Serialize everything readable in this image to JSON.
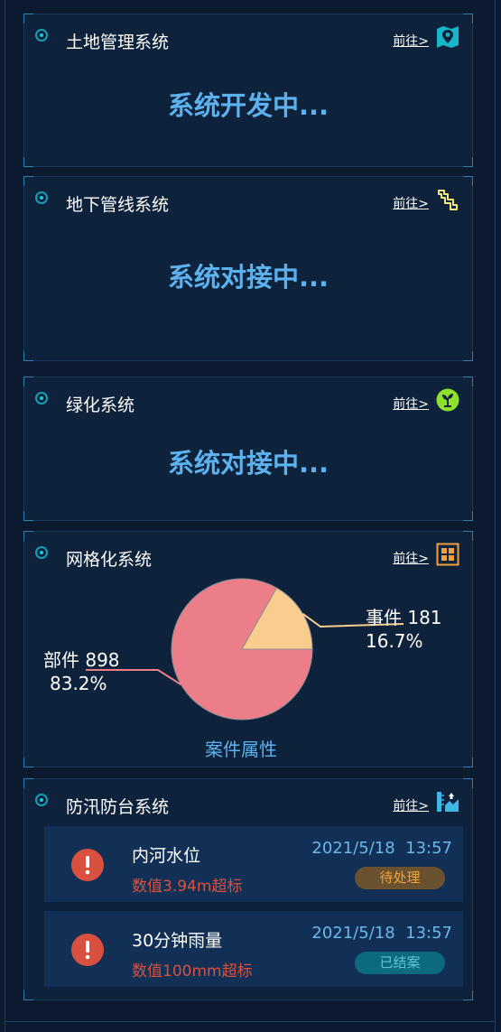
{
  "panels": {
    "land": {
      "title": "土地管理系统",
      "goto_label": "前往>",
      "icon": "map-pin-icon",
      "status": "系统开发中..."
    },
    "pipeline": {
      "title": "地下管线系统",
      "goto_label": "前往>",
      "icon": "pipe-icon",
      "status": "系统对接中..."
    },
    "greening": {
      "title": "绿化系统",
      "goto_label": "前往>",
      "icon": "plant-icon",
      "status": "系统对接中..."
    },
    "grid": {
      "title": "网格化系统",
      "goto_label": "前往>",
      "icon": "grid-icon",
      "chart_caption": "案件属性"
    },
    "flood": {
      "title": "防汛防台系统",
      "goto_label": "前往>",
      "icon": "water-level-icon",
      "alarms": [
        {
          "name": "内河水位",
          "detail": "数值3.94m超标",
          "time": "2021/5/18  13:57",
          "status": "待处理",
          "icon": "alert-icon"
        },
        {
          "name": "30分钟雨量",
          "detail": "数值100mm超标",
          "time": "2021/5/18  13:57",
          "status": "已结案",
          "icon": "alert-icon"
        }
      ]
    }
  },
  "chart_data": {
    "type": "pie",
    "title": "案件属性",
    "slices": [
      {
        "name": "部件",
        "value": 898,
        "percent": "83.2%",
        "color": "#ec7e89",
        "label_value": "898"
      },
      {
        "name": "事件",
        "value": 181,
        "percent": "16.7%",
        "color": "#f9cd8e",
        "label_value": "181"
      }
    ]
  },
  "colors": {
    "accent": "#5cb2ee",
    "alert": "#d9503f",
    "pending": "#f2a437",
    "closed": "#5cc8d8"
  }
}
